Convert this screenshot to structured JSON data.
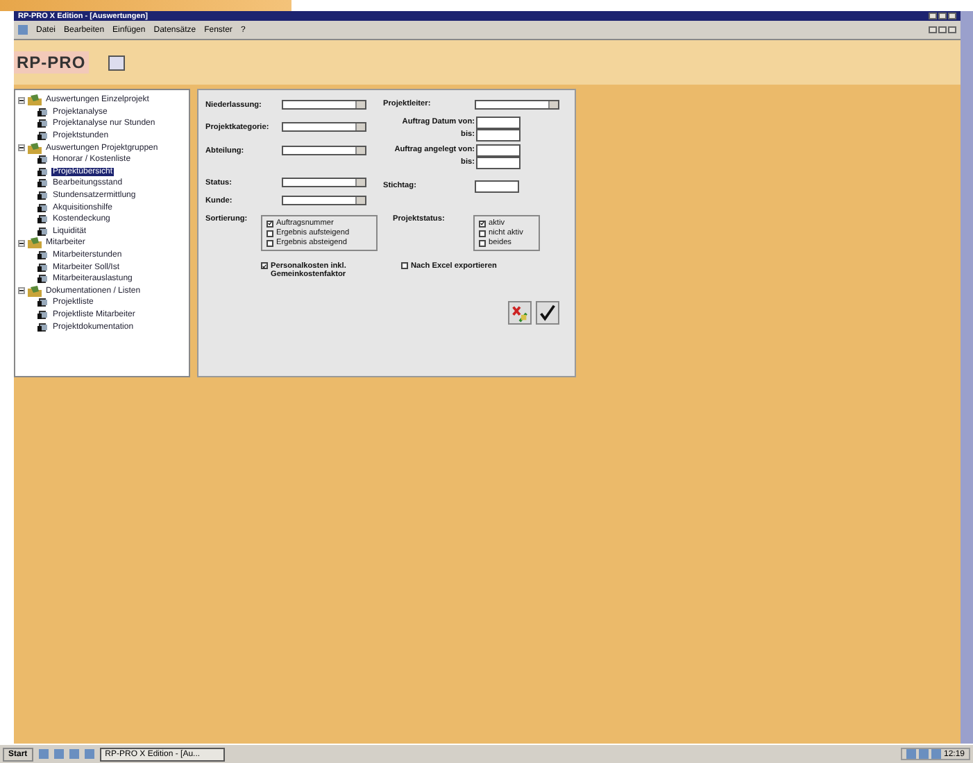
{
  "window": {
    "title": "RP-PRO X Edition - [Auswertungen]"
  },
  "menu": [
    "Datei",
    "Bearbeiten",
    "Einfügen",
    "Datensätze",
    "Fenster",
    "?"
  ],
  "logo": "RP-PRO",
  "tree": [
    {
      "label": "Auswertungen Einzelprojekt",
      "expanded": true,
      "selected": false,
      "children": [
        {
          "label": "Projektanalyse",
          "selected": false
        },
        {
          "label": "Projektanalyse nur Stunden",
          "selected": false
        },
        {
          "label": "Projektstunden",
          "selected": false
        }
      ]
    },
    {
      "label": "Auswertungen Projektgruppen",
      "expanded": true,
      "selected": false,
      "children": [
        {
          "label": "Honorar / Kostenliste",
          "selected": false
        },
        {
          "label": "Projektübersicht",
          "selected": true
        },
        {
          "label": "Bearbeitungsstand",
          "selected": false
        },
        {
          "label": "Stundensatzermittlung",
          "selected": false
        },
        {
          "label": "Akquisitionshilfe",
          "selected": false
        },
        {
          "label": "Kostendeckung",
          "selected": false
        },
        {
          "label": "Liquidität",
          "selected": false
        }
      ]
    },
    {
      "label": "Mitarbeiter",
      "expanded": true,
      "selected": false,
      "children": [
        {
          "label": "Mitarbeiterstunden",
          "selected": false
        },
        {
          "label": "Mitarbeiter Soll/Ist",
          "selected": false
        },
        {
          "label": "Mitarbeiterauslastung",
          "selected": false
        }
      ]
    },
    {
      "label": "Dokumentationen / Listen",
      "expanded": true,
      "selected": false,
      "children": [
        {
          "label": "Projektliste",
          "selected": false
        },
        {
          "label": "Projektliste Mitarbeiter",
          "selected": false
        },
        {
          "label": "Projektdokumentation",
          "selected": false
        }
      ]
    }
  ],
  "form": {
    "left_fields": [
      {
        "kind": "dropdown",
        "label": "Niederlassung:"
      },
      {
        "kind": "dropdown",
        "label": "Projektkategorie:"
      },
      {
        "kind": "dropdown",
        "label": "Abteilung:"
      },
      {
        "kind": "dropdown",
        "label": "Status:"
      },
      {
        "kind": "dropdown",
        "label": "Kunde:"
      }
    ],
    "right_fields": [
      {
        "kind": "dropdown",
        "label": "Projektleiter:"
      },
      {
        "kind": "range",
        "label": "Auftrag Datum von:",
        "label_to": "bis:"
      },
      {
        "kind": "range",
        "label": "Auftrag angelegt von:",
        "label_to": "bis:"
      },
      {
        "kind": "text",
        "label": "Stichtag:"
      }
    ],
    "sort": {
      "label": "Sortierung:",
      "options": [
        {
          "label": "Auftragsnummer",
          "checked": true
        },
        {
          "label": "Ergebnis aufsteigend",
          "checked": false
        },
        {
          "label": "Ergebnis absteigend",
          "checked": false
        }
      ]
    },
    "status": {
      "label": "Projektstatus:",
      "options": [
        {
          "label": "aktiv",
          "checked": true
        },
        {
          "label": "nicht aktiv",
          "checked": false
        },
        {
          "label": "beides",
          "checked": false
        }
      ]
    },
    "checks": [
      {
        "label": "Personalkosten inkl. Gemeinkostenfaktor",
        "checked": true
      },
      {
        "label": "Nach Excel exportieren",
        "checked": false
      }
    ]
  },
  "taskbar": {
    "start": "Start",
    "task": "RP-PRO X Edition - [Au...",
    "clock": "12:19"
  }
}
